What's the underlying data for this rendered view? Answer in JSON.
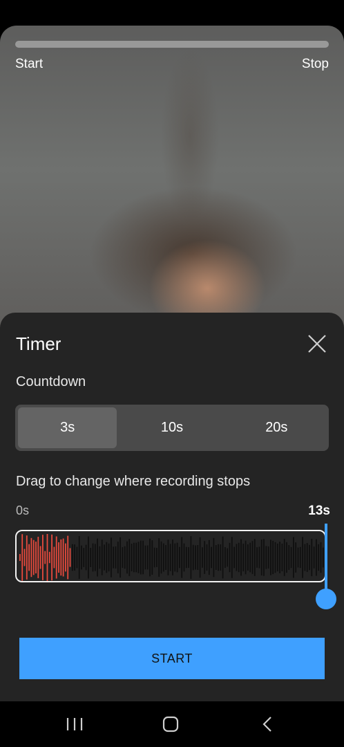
{
  "preview": {
    "progress_fraction": 0,
    "start_label": "Start",
    "stop_label": "Stop"
  },
  "timer": {
    "title": "Timer",
    "close_icon": "close-icon",
    "countdown_label": "Countdown",
    "countdown_options": [
      "3s",
      "10s",
      "20s"
    ],
    "countdown_selected": "3s",
    "drag_label": "Drag to change where recording stops",
    "range_start": "0s",
    "range_end": "13s",
    "start_button": "START"
  },
  "colors": {
    "accent": "#3fa0ff",
    "recorded_wave": "#e84a3d",
    "remaining_wave": "#0f0f0f",
    "sheet_bg": "#242424"
  },
  "nav": {
    "recents_icon": "recents-icon",
    "home_icon": "home-icon",
    "back_icon": "back-icon"
  }
}
